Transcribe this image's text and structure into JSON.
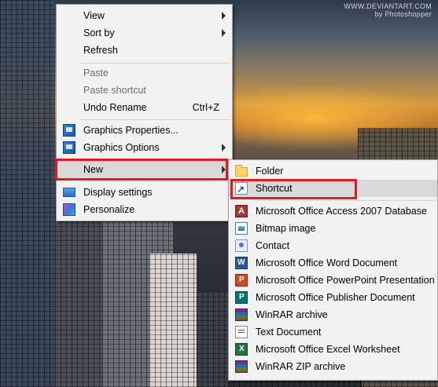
{
  "watermark": {
    "line1": "WWW.DEVIANTART.COM",
    "line2": "by Photoshopper"
  },
  "context_menu": {
    "items": [
      {
        "id": "view",
        "label": "View",
        "has_submenu": true
      },
      {
        "id": "sort_by",
        "label": "Sort by",
        "has_submenu": true
      },
      {
        "id": "refresh",
        "label": "Refresh"
      },
      {
        "id": "paste",
        "label": "Paste",
        "disabled": true
      },
      {
        "id": "paste_shortcut",
        "label": "Paste shortcut",
        "disabled": true
      },
      {
        "id": "undo_rename",
        "label": "Undo Rename",
        "shortcut": "Ctrl+Z"
      },
      {
        "id": "graphics_properties",
        "label": "Graphics Properties...",
        "icon": "graphics-icon"
      },
      {
        "id": "graphics_options",
        "label": "Graphics Options",
        "icon": "graphics-icon",
        "has_submenu": true
      },
      {
        "id": "new",
        "label": "New",
        "has_submenu": true,
        "highlighted": true
      },
      {
        "id": "display_settings",
        "label": "Display settings",
        "icon": "monitor-icon"
      },
      {
        "id": "personalize",
        "label": "Personalize",
        "icon": "personalize-icon"
      }
    ]
  },
  "new_submenu": {
    "items": [
      {
        "id": "folder",
        "label": "Folder",
        "icon": "folder-icon"
      },
      {
        "id": "shortcut",
        "label": "Shortcut",
        "icon": "shortcut-icon",
        "highlighted": true
      },
      {
        "id": "access",
        "label": "Microsoft Office Access 2007 Database",
        "icon": "access-icon"
      },
      {
        "id": "bitmap",
        "label": "Bitmap image",
        "icon": "bitmap-icon"
      },
      {
        "id": "contact",
        "label": "Contact",
        "icon": "contact-icon"
      },
      {
        "id": "word",
        "label": "Microsoft Office Word Document",
        "icon": "word-icon"
      },
      {
        "id": "powerpoint",
        "label": "Microsoft Office PowerPoint Presentation",
        "icon": "powerpoint-icon"
      },
      {
        "id": "publisher",
        "label": "Microsoft Office Publisher Document",
        "icon": "publisher-icon"
      },
      {
        "id": "winrar",
        "label": "WinRAR archive",
        "icon": "winrar-icon"
      },
      {
        "id": "text",
        "label": "Text Document",
        "icon": "text-document-icon"
      },
      {
        "id": "excel",
        "label": "Microsoft Office Excel Worksheet",
        "icon": "excel-icon"
      },
      {
        "id": "winrar_zip",
        "label": "WinRAR ZIP archive",
        "icon": "winrar-icon"
      }
    ]
  },
  "annotation": {
    "color": "#e11b22"
  },
  "colors": {
    "menu_bg": "#f2f2f2",
    "hover_bg": "#d9d9d9",
    "disabled_text": "#6d6d6d"
  }
}
